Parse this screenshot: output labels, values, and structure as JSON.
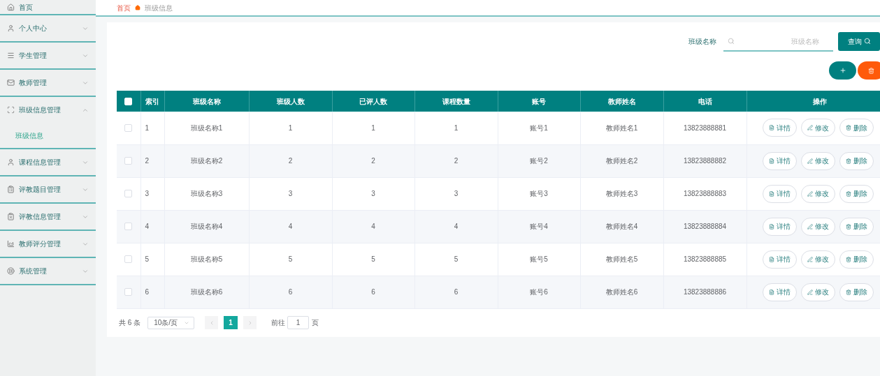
{
  "sidebar": {
    "items": [
      {
        "label": "首页",
        "has_arrow": false
      },
      {
        "label": "个人中心",
        "expanded": false,
        "has_arrow": true
      },
      {
        "label": "学生管理",
        "expanded": false,
        "has_arrow": true
      },
      {
        "label": "教师管理",
        "expanded": false,
        "has_arrow": true
      },
      {
        "label": "班级信息管理",
        "expanded": true,
        "has_arrow": true,
        "children": [
          {
            "label": "班级信息",
            "selected": true
          }
        ]
      },
      {
        "label": "课程信息管理",
        "expanded": false,
        "has_arrow": true
      },
      {
        "label": "评教题目管理",
        "expanded": false,
        "has_arrow": true
      },
      {
        "label": "评教信息管理",
        "expanded": false,
        "has_arrow": true
      },
      {
        "label": "教师评分管理",
        "expanded": false,
        "has_arrow": true
      },
      {
        "label": "系统管理",
        "expanded": false,
        "has_arrow": true
      }
    ]
  },
  "breadcrumb": [
    "首页",
    "班级信息"
  ],
  "search": {
    "label": "班级名称",
    "placeholder": "班级名称",
    "button": "查询"
  },
  "table": {
    "header_checked": false,
    "columns": [
      "索引",
      "班级名称",
      "班级人数",
      "已评人数",
      "课程数量",
      "账号",
      "教师姓名",
      "电话",
      "操作"
    ],
    "rows": [
      {
        "checked": false,
        "cells": [
          "1",
          "班级名称1",
          "1",
          "1",
          "1",
          "账号1",
          "教师姓名1",
          "13823888881"
        ],
        "actions": [
          "详情",
          "修改",
          "删除"
        ]
      },
      {
        "checked": false,
        "cells": [
          "2",
          "班级名称2",
          "2",
          "2",
          "2",
          "账号2",
          "教师姓名2",
          "13823888882"
        ],
        "actions": [
          "详情",
          "修改",
          "删除"
        ]
      },
      {
        "checked": false,
        "cells": [
          "3",
          "班级名称3",
          "3",
          "3",
          "3",
          "账号3",
          "教师姓名3",
          "13823888883"
        ],
        "actions": [
          "详情",
          "修改",
          "删除"
        ]
      },
      {
        "checked": false,
        "cells": [
          "4",
          "班级名称4",
          "4",
          "4",
          "4",
          "账号4",
          "教师姓名4",
          "13823888884"
        ],
        "actions": [
          "详情",
          "修改",
          "删除"
        ]
      },
      {
        "checked": false,
        "cells": [
          "5",
          "班级名称5",
          "5",
          "5",
          "5",
          "账号5",
          "教师姓名5",
          "13823888885"
        ],
        "actions": [
          "详情",
          "修改",
          "删除"
        ]
      },
      {
        "checked": false,
        "cells": [
          "6",
          "班级名称6",
          "6",
          "6",
          "6",
          "账号6",
          "教师姓名6",
          "13823888886"
        ],
        "actions": [
          "详情",
          "修改",
          "删除"
        ]
      }
    ]
  },
  "pagination": {
    "total": "共 6 条",
    "page_size": "10条/页",
    "pages": [
      {
        "label": "1",
        "selected": true
      }
    ],
    "goto_label": "前往",
    "goto_value": "1",
    "goto_suffix": "页"
  }
}
